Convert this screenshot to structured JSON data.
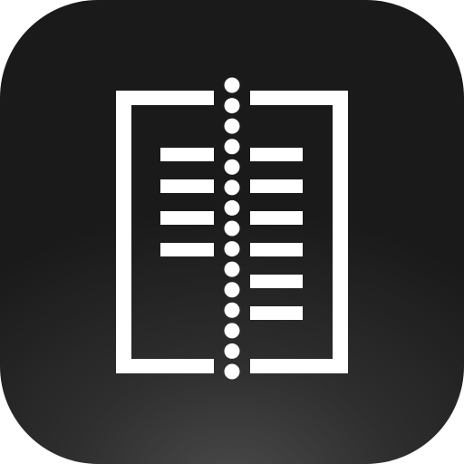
{
  "icon": {
    "name": "split-document-compare-icon",
    "colors": {
      "background_center": "#4a4a4a",
      "background_edge": "#1a1a1a",
      "glyph": "#ffffff"
    },
    "left_page_line_count": 4,
    "right_page_line_count": 6,
    "perforation_dot_count": 15
  }
}
